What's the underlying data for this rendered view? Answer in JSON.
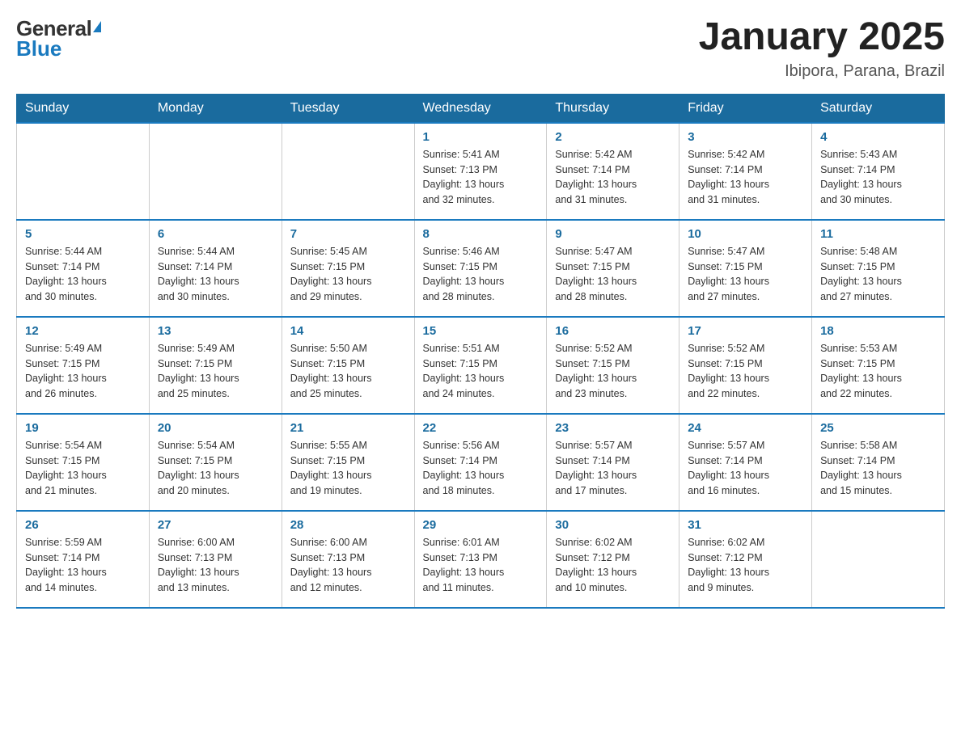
{
  "logo": {
    "general": "General",
    "blue": "Blue"
  },
  "title": "January 2025",
  "subtitle": "Ibipora, Parana, Brazil",
  "headers": [
    "Sunday",
    "Monday",
    "Tuesday",
    "Wednesday",
    "Thursday",
    "Friday",
    "Saturday"
  ],
  "weeks": [
    [
      {
        "day": "",
        "info": ""
      },
      {
        "day": "",
        "info": ""
      },
      {
        "day": "",
        "info": ""
      },
      {
        "day": "1",
        "info": "Sunrise: 5:41 AM\nSunset: 7:13 PM\nDaylight: 13 hours\nand 32 minutes."
      },
      {
        "day": "2",
        "info": "Sunrise: 5:42 AM\nSunset: 7:14 PM\nDaylight: 13 hours\nand 31 minutes."
      },
      {
        "day": "3",
        "info": "Sunrise: 5:42 AM\nSunset: 7:14 PM\nDaylight: 13 hours\nand 31 minutes."
      },
      {
        "day": "4",
        "info": "Sunrise: 5:43 AM\nSunset: 7:14 PM\nDaylight: 13 hours\nand 30 minutes."
      }
    ],
    [
      {
        "day": "5",
        "info": "Sunrise: 5:44 AM\nSunset: 7:14 PM\nDaylight: 13 hours\nand 30 minutes."
      },
      {
        "day": "6",
        "info": "Sunrise: 5:44 AM\nSunset: 7:14 PM\nDaylight: 13 hours\nand 30 minutes."
      },
      {
        "day": "7",
        "info": "Sunrise: 5:45 AM\nSunset: 7:15 PM\nDaylight: 13 hours\nand 29 minutes."
      },
      {
        "day": "8",
        "info": "Sunrise: 5:46 AM\nSunset: 7:15 PM\nDaylight: 13 hours\nand 28 minutes."
      },
      {
        "day": "9",
        "info": "Sunrise: 5:47 AM\nSunset: 7:15 PM\nDaylight: 13 hours\nand 28 minutes."
      },
      {
        "day": "10",
        "info": "Sunrise: 5:47 AM\nSunset: 7:15 PM\nDaylight: 13 hours\nand 27 minutes."
      },
      {
        "day": "11",
        "info": "Sunrise: 5:48 AM\nSunset: 7:15 PM\nDaylight: 13 hours\nand 27 minutes."
      }
    ],
    [
      {
        "day": "12",
        "info": "Sunrise: 5:49 AM\nSunset: 7:15 PM\nDaylight: 13 hours\nand 26 minutes."
      },
      {
        "day": "13",
        "info": "Sunrise: 5:49 AM\nSunset: 7:15 PM\nDaylight: 13 hours\nand 25 minutes."
      },
      {
        "day": "14",
        "info": "Sunrise: 5:50 AM\nSunset: 7:15 PM\nDaylight: 13 hours\nand 25 minutes."
      },
      {
        "day": "15",
        "info": "Sunrise: 5:51 AM\nSunset: 7:15 PM\nDaylight: 13 hours\nand 24 minutes."
      },
      {
        "day": "16",
        "info": "Sunrise: 5:52 AM\nSunset: 7:15 PM\nDaylight: 13 hours\nand 23 minutes."
      },
      {
        "day": "17",
        "info": "Sunrise: 5:52 AM\nSunset: 7:15 PM\nDaylight: 13 hours\nand 22 minutes."
      },
      {
        "day": "18",
        "info": "Sunrise: 5:53 AM\nSunset: 7:15 PM\nDaylight: 13 hours\nand 22 minutes."
      }
    ],
    [
      {
        "day": "19",
        "info": "Sunrise: 5:54 AM\nSunset: 7:15 PM\nDaylight: 13 hours\nand 21 minutes."
      },
      {
        "day": "20",
        "info": "Sunrise: 5:54 AM\nSunset: 7:15 PM\nDaylight: 13 hours\nand 20 minutes."
      },
      {
        "day": "21",
        "info": "Sunrise: 5:55 AM\nSunset: 7:15 PM\nDaylight: 13 hours\nand 19 minutes."
      },
      {
        "day": "22",
        "info": "Sunrise: 5:56 AM\nSunset: 7:14 PM\nDaylight: 13 hours\nand 18 minutes."
      },
      {
        "day": "23",
        "info": "Sunrise: 5:57 AM\nSunset: 7:14 PM\nDaylight: 13 hours\nand 17 minutes."
      },
      {
        "day": "24",
        "info": "Sunrise: 5:57 AM\nSunset: 7:14 PM\nDaylight: 13 hours\nand 16 minutes."
      },
      {
        "day": "25",
        "info": "Sunrise: 5:58 AM\nSunset: 7:14 PM\nDaylight: 13 hours\nand 15 minutes."
      }
    ],
    [
      {
        "day": "26",
        "info": "Sunrise: 5:59 AM\nSunset: 7:14 PM\nDaylight: 13 hours\nand 14 minutes."
      },
      {
        "day": "27",
        "info": "Sunrise: 6:00 AM\nSunset: 7:13 PM\nDaylight: 13 hours\nand 13 minutes."
      },
      {
        "day": "28",
        "info": "Sunrise: 6:00 AM\nSunset: 7:13 PM\nDaylight: 13 hours\nand 12 minutes."
      },
      {
        "day": "29",
        "info": "Sunrise: 6:01 AM\nSunset: 7:13 PM\nDaylight: 13 hours\nand 11 minutes."
      },
      {
        "day": "30",
        "info": "Sunrise: 6:02 AM\nSunset: 7:12 PM\nDaylight: 13 hours\nand 10 minutes."
      },
      {
        "day": "31",
        "info": "Sunrise: 6:02 AM\nSunset: 7:12 PM\nDaylight: 13 hours\nand 9 minutes."
      },
      {
        "day": "",
        "info": ""
      }
    ]
  ]
}
